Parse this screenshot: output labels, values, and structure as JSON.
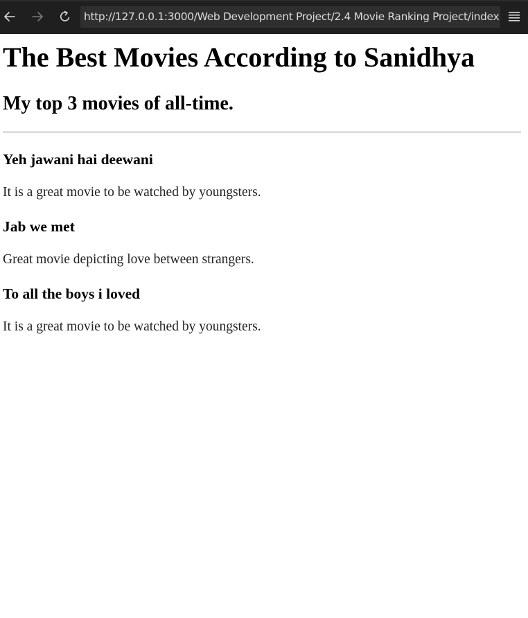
{
  "browser": {
    "url": "http://127.0.0.1:3000/Web Development Project/2.4 Movie Ranking Project/index.",
    "icons": {
      "back": "arrow-left-icon",
      "forward": "arrow-right-icon",
      "reload": "reload-icon",
      "menu": "hamburger-menu-icon"
    },
    "colors": {
      "toolbar": "#1f1f1f",
      "url_field": "#2f2f2f",
      "url_text": "#dcdcdc"
    }
  },
  "page": {
    "title": "The Best Movies According to Sanidhya",
    "subtitle": "My top 3 movies of all-time.",
    "movies": [
      {
        "title": "Yeh jawani hai deewani",
        "description": "It is a great movie to be watched by youngsters."
      },
      {
        "title": "Jab we met",
        "description": "Great movie depicting love between strangers."
      },
      {
        "title": "To all the boys i loved",
        "description": "It is a great movie to be watched by youngsters."
      }
    ]
  }
}
